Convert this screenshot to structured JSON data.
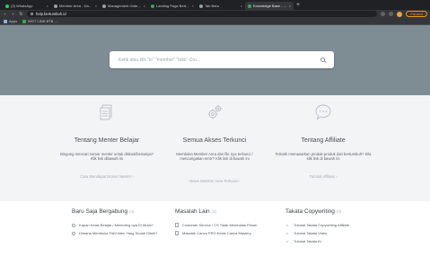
{
  "browser": {
    "tabs": [
      {
        "label": "(3) WhatsApp",
        "color": "#25d366",
        "active": false
      },
      {
        "label": "Member Area - Dashboard",
        "color": "#9aa0a6",
        "active": false
      },
      {
        "label": "Management Order - Dbu",
        "color": "#9aa0a6",
        "active": false
      },
      {
        "label": "Landing Page Bertumbuh",
        "color": "#34a853",
        "active": false
      },
      {
        "label": "Tab Baru",
        "color": "#9aa0a6",
        "active": false
      },
      {
        "label": "Knowledge Base - Kami Cs",
        "color": "#34a853",
        "active": true
      }
    ],
    "new_tab": "+",
    "url": "help.bertumbuh.id",
    "paused_label": "Paused",
    "bookmarks": [
      {
        "label": "Apps",
        "color": "#8ab4f8"
      },
      {
        "label": "WGT LINK BTB -...",
        "color": "#34a853"
      }
    ]
  },
  "search": {
    "placeholder": "Ketik atau klik \"lo\" \"member\" \"bdio\" Cru..."
  },
  "features": [
    {
      "icon": "document-icon",
      "title": "Tentang Menter Belajar",
      "description": "Bingung mencari nomor menter untuk diskusi/bertanya? Klik link dibawah ini",
      "link": "Cara Mendapat Nomer Menter ›"
    },
    {
      "icon": "gears-icon",
      "title": "Semua Akses Terkunci",
      "description": "Membuka Member Area dan file nya terkunci / mencurigakan error? Klik link di bawah ini",
      "link": "Akses Member Area Terkunci ›"
    },
    {
      "icon": "chat-bubble-icon",
      "title": "Tentang Affiliate",
      "description": "Tertarik memasarkan produk-produk dari bertumbuh? Sila klik link di bawah ini",
      "link": "Tutorial Affiliate ›"
    }
  ],
  "lists": [
    {
      "heading": "Baru Saja Bergabung",
      "count": "(4)",
      "bullet": "question",
      "items": [
        "Kapan Kelas Belajar / Mentoring nya Di Mulai?",
        "Dimana Membuka File/Video Yang Sudah Dibeli?"
      ]
    },
    {
      "heading": "Masalah Lain",
      "count": "(3)",
      "bullet": "doc",
      "items": [
        "Customer Service / CS Tidak Membalas Pesan",
        "Masalah Canva PRO Kelas Canva Mastery"
      ]
    },
    {
      "heading": "Takata Copywriting",
      "count": "(3)",
      "bullet": "arrow",
      "items": [
        "Tutorial Takata Copywriting Affiliate",
        "Tutorial Takata Video",
        "Tutorial Takata AI"
      ]
    }
  ]
}
